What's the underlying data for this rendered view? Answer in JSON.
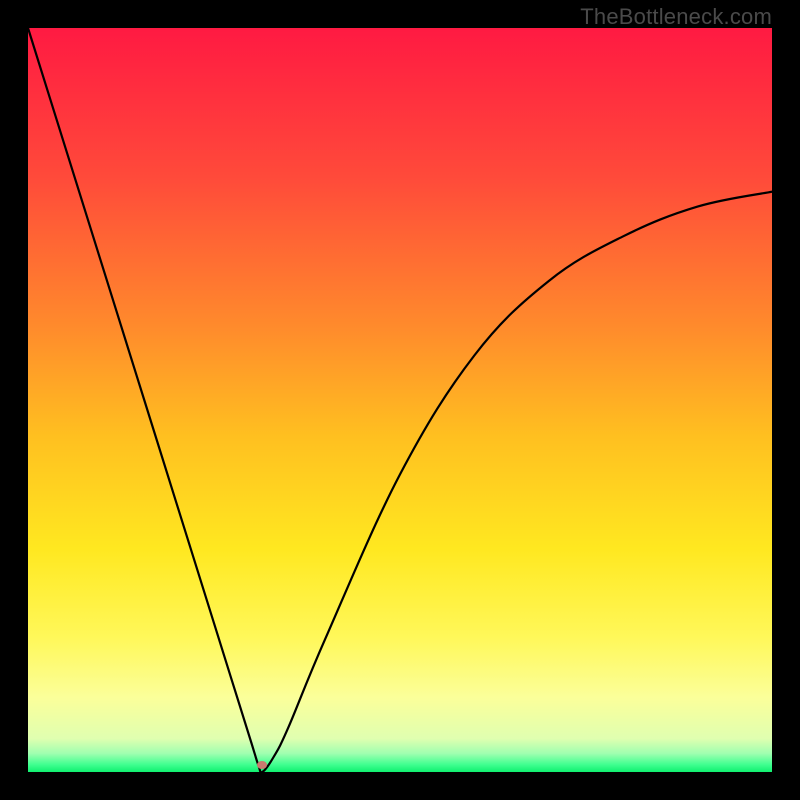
{
  "watermark": "TheBottleneck.com",
  "chart_data": {
    "type": "line",
    "title": "",
    "xlabel": "",
    "ylabel": "",
    "xlim": [
      0,
      100
    ],
    "ylim": [
      0,
      100
    ],
    "grid": false,
    "series": [
      {
        "name": "bottleneck-curve",
        "x": [
          0,
          5,
          10,
          15,
          20,
          25,
          28,
          30,
          31,
          31.5,
          33,
          35,
          40,
          50,
          60,
          70,
          80,
          90,
          100
        ],
        "values": [
          100,
          84,
          68,
          52,
          36,
          20,
          10.4,
          4.0,
          0.8,
          0.0,
          2.0,
          6.0,
          18,
          40,
          56,
          66,
          72,
          76,
          78
        ]
      }
    ],
    "marker": {
      "x": 31.5,
      "y": 1.0,
      "color": "#c97a6f"
    },
    "background_gradient": {
      "stops": [
        {
          "pos": 0.0,
          "color": "#ff1a42"
        },
        {
          "pos": 0.2,
          "color": "#ff4a3a"
        },
        {
          "pos": 0.4,
          "color": "#ff8a2c"
        },
        {
          "pos": 0.55,
          "color": "#ffc020"
        },
        {
          "pos": 0.7,
          "color": "#ffe820"
        },
        {
          "pos": 0.82,
          "color": "#fff85a"
        },
        {
          "pos": 0.9,
          "color": "#fbff9a"
        },
        {
          "pos": 0.955,
          "color": "#e0ffb0"
        },
        {
          "pos": 0.975,
          "color": "#a0ffb0"
        },
        {
          "pos": 0.99,
          "color": "#40ff90"
        },
        {
          "pos": 1.0,
          "color": "#10f070"
        }
      ]
    }
  }
}
